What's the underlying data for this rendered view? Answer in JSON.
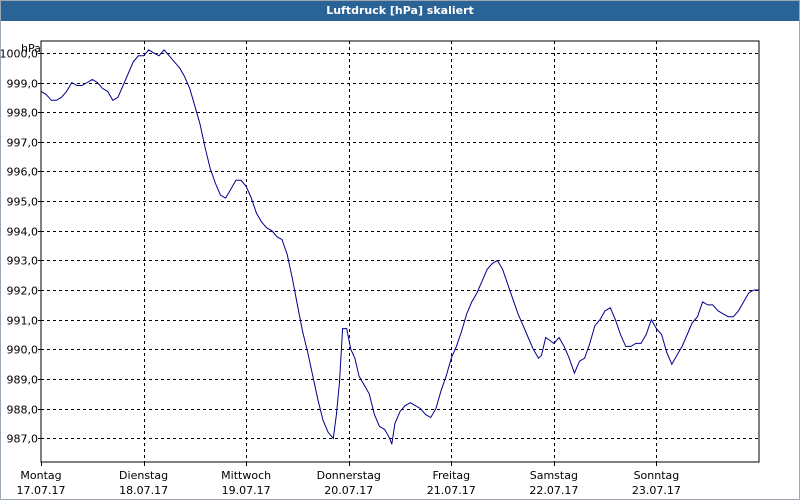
{
  "window": {
    "title": "Luftdruck [hPa] skaliert"
  },
  "chart_data": {
    "type": "line",
    "title": "Luftdruck [hPa] skaliert",
    "ylabel": "hPa",
    "xlabel": "",
    "ylim": [
      986.2,
      1000.4
    ],
    "xlim": [
      0,
      7.0
    ],
    "grid": true,
    "y_ticks": [
      "987,0",
      "988,0",
      "989,0",
      "990,0",
      "991,0",
      "992,0",
      "993,0",
      "994,0",
      "995,0",
      "996,0",
      "997,0",
      "998,0",
      "999,0",
      "1000,0"
    ],
    "x_ticks": [
      {
        "day": "Montag",
        "date": "17.07.17"
      },
      {
        "day": "Dienstag",
        "date": "18.07.17"
      },
      {
        "day": "Mittwoch",
        "date": "19.07.17"
      },
      {
        "day": "Donnerstag",
        "date": "20.07.17"
      },
      {
        "day": "Freitag",
        "date": "21.07.17"
      },
      {
        "day": "Samstag",
        "date": "22.07.17"
      },
      {
        "day": "Sonntag",
        "date": "23.07.17"
      }
    ],
    "series": [
      {
        "color": "#00008b",
        "points": [
          [
            0.0,
            998.7
          ],
          [
            0.05,
            998.6
          ],
          [
            0.1,
            998.4
          ],
          [
            0.15,
            998.4
          ],
          [
            0.2,
            998.5
          ],
          [
            0.25,
            998.7
          ],
          [
            0.3,
            999.0
          ],
          [
            0.35,
            998.9
          ],
          [
            0.4,
            998.9
          ],
          [
            0.45,
            999.0
          ],
          [
            0.5,
            999.1
          ],
          [
            0.55,
            999.0
          ],
          [
            0.6,
            998.8
          ],
          [
            0.65,
            998.7
          ],
          [
            0.7,
            998.4
          ],
          [
            0.75,
            998.5
          ],
          [
            0.8,
            998.9
          ],
          [
            0.85,
            999.3
          ],
          [
            0.9,
            999.7
          ],
          [
            0.95,
            999.9
          ],
          [
            1.0,
            999.9
          ],
          [
            1.05,
            1000.1
          ],
          [
            1.1,
            1000.0
          ],
          [
            1.15,
            999.9
          ],
          [
            1.2,
            1000.1
          ],
          [
            1.25,
            999.9
          ],
          [
            1.3,
            999.7
          ],
          [
            1.35,
            999.5
          ],
          [
            1.4,
            999.2
          ],
          [
            1.45,
            998.8
          ],
          [
            1.5,
            998.2
          ],
          [
            1.55,
            997.6
          ],
          [
            1.6,
            996.8
          ],
          [
            1.65,
            996.1
          ],
          [
            1.7,
            995.6
          ],
          [
            1.75,
            995.2
          ],
          [
            1.8,
            995.1
          ],
          [
            1.85,
            995.4
          ],
          [
            1.9,
            995.7
          ],
          [
            1.95,
            995.7
          ],
          [
            2.0,
            995.5
          ],
          [
            2.05,
            995.1
          ],
          [
            2.1,
            994.6
          ],
          [
            2.15,
            994.3
          ],
          [
            2.2,
            994.1
          ],
          [
            2.25,
            994.0
          ],
          [
            2.3,
            993.8
          ],
          [
            2.35,
            993.7
          ],
          [
            2.4,
            993.2
          ],
          [
            2.45,
            992.4
          ],
          [
            2.5,
            991.5
          ],
          [
            2.55,
            990.6
          ],
          [
            2.6,
            989.9
          ],
          [
            2.65,
            989.1
          ],
          [
            2.7,
            988.3
          ],
          [
            2.75,
            987.6
          ],
          [
            2.8,
            987.2
          ],
          [
            2.85,
            987.0
          ],
          [
            2.88,
            987.8
          ],
          [
            2.91,
            988.9
          ],
          [
            2.94,
            990.7
          ],
          [
            2.98,
            990.7
          ],
          [
            3.02,
            990.0
          ],
          [
            3.06,
            989.7
          ],
          [
            3.1,
            989.1
          ],
          [
            3.15,
            988.8
          ],
          [
            3.2,
            988.5
          ],
          [
            3.25,
            987.8
          ],
          [
            3.3,
            987.4
          ],
          [
            3.35,
            987.3
          ],
          [
            3.4,
            987.0
          ],
          [
            3.42,
            986.8
          ],
          [
            3.45,
            987.5
          ],
          [
            3.5,
            987.9
          ],
          [
            3.55,
            988.1
          ],
          [
            3.6,
            988.2
          ],
          [
            3.65,
            988.1
          ],
          [
            3.7,
            988.0
          ],
          [
            3.75,
            987.8
          ],
          [
            3.8,
            987.7
          ],
          [
            3.85,
            988.0
          ],
          [
            3.9,
            988.6
          ],
          [
            3.95,
            989.1
          ],
          [
            4.0,
            989.7
          ],
          [
            4.05,
            990.1
          ],
          [
            4.1,
            990.6
          ],
          [
            4.15,
            991.2
          ],
          [
            4.2,
            991.6
          ],
          [
            4.25,
            991.9
          ],
          [
            4.3,
            992.3
          ],
          [
            4.35,
            992.7
          ],
          [
            4.4,
            992.9
          ],
          [
            4.45,
            993.0
          ],
          [
            4.5,
            992.7
          ],
          [
            4.55,
            992.2
          ],
          [
            4.6,
            991.7
          ],
          [
            4.65,
            991.2
          ],
          [
            4.7,
            990.8
          ],
          [
            4.75,
            990.4
          ],
          [
            4.8,
            990.0
          ],
          [
            4.85,
            989.7
          ],
          [
            4.88,
            989.8
          ],
          [
            4.92,
            990.4
          ],
          [
            4.96,
            990.3
          ],
          [
            5.0,
            990.2
          ],
          [
            5.05,
            990.4
          ],
          [
            5.1,
            990.1
          ],
          [
            5.15,
            989.7
          ],
          [
            5.2,
            989.2
          ],
          [
            5.25,
            989.6
          ],
          [
            5.3,
            989.7
          ],
          [
            5.35,
            990.2
          ],
          [
            5.4,
            990.8
          ],
          [
            5.45,
            991.0
          ],
          [
            5.5,
            991.3
          ],
          [
            5.55,
            991.4
          ],
          [
            5.6,
            991.0
          ],
          [
            5.65,
            990.5
          ],
          [
            5.7,
            990.1
          ],
          [
            5.75,
            990.1
          ],
          [
            5.8,
            990.2
          ],
          [
            5.85,
            990.2
          ],
          [
            5.9,
            990.5
          ],
          [
            5.95,
            991.0
          ],
          [
            6.0,
            990.7
          ],
          [
            6.05,
            990.5
          ],
          [
            6.1,
            989.9
          ],
          [
            6.15,
            989.5
          ],
          [
            6.2,
            989.8
          ],
          [
            6.25,
            990.1
          ],
          [
            6.3,
            990.5
          ],
          [
            6.35,
            990.9
          ],
          [
            6.4,
            991.1
          ],
          [
            6.45,
            991.6
          ],
          [
            6.5,
            991.5
          ],
          [
            6.55,
            991.5
          ],
          [
            6.6,
            991.3
          ],
          [
            6.65,
            991.2
          ],
          [
            6.7,
            991.1
          ],
          [
            6.75,
            991.1
          ],
          [
            6.8,
            991.3
          ],
          [
            6.85,
            991.6
          ],
          [
            6.9,
            991.9
          ],
          [
            6.95,
            992.0
          ],
          [
            7.0,
            992.0
          ]
        ]
      }
    ]
  }
}
